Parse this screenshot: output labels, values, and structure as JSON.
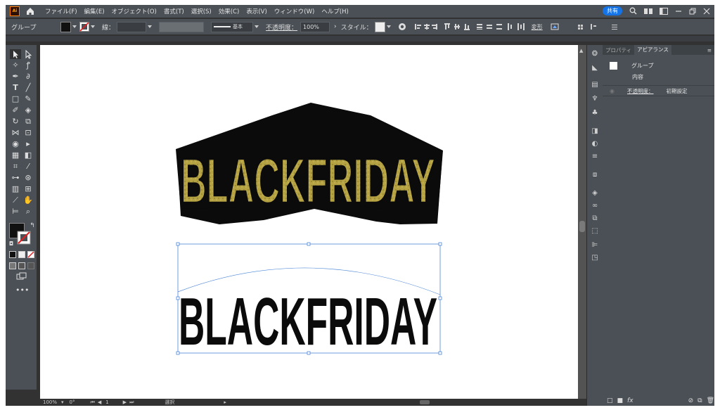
{
  "menubar": {
    "menus": [
      "ファイル(F)",
      "編集(E)",
      "オブジェクト(O)",
      "書式(T)",
      "選択(S)",
      "効果(C)",
      "表示(V)",
      "ウィンドウ(W)",
      "ヘルプ(H)"
    ],
    "share": "共有",
    "logo": "Ai"
  },
  "control": {
    "selection": "グループ",
    "stroke_label": "線：",
    "profile": "基本",
    "opacity_label": "不透明度：",
    "opacity_value": "100%",
    "style_label": "スタイル：",
    "transform_label": "変形"
  },
  "panel": {
    "tab_properties": "プロパティ",
    "tab_appearance": "アピアランス",
    "group_label": "グループ",
    "content_label": "内容",
    "opacity_label": "不透明度：",
    "opacity_value": "初期設定"
  },
  "artwork": {
    "text_top": "BLACKFRIDAY",
    "text_bottom": "BLACKFRIDAY",
    "gold_color": "#b5a243",
    "black_color": "#0b0b0b"
  },
  "status": {
    "zoom": "100%",
    "rotation": "0°",
    "page": "1",
    "tool": "選択"
  }
}
